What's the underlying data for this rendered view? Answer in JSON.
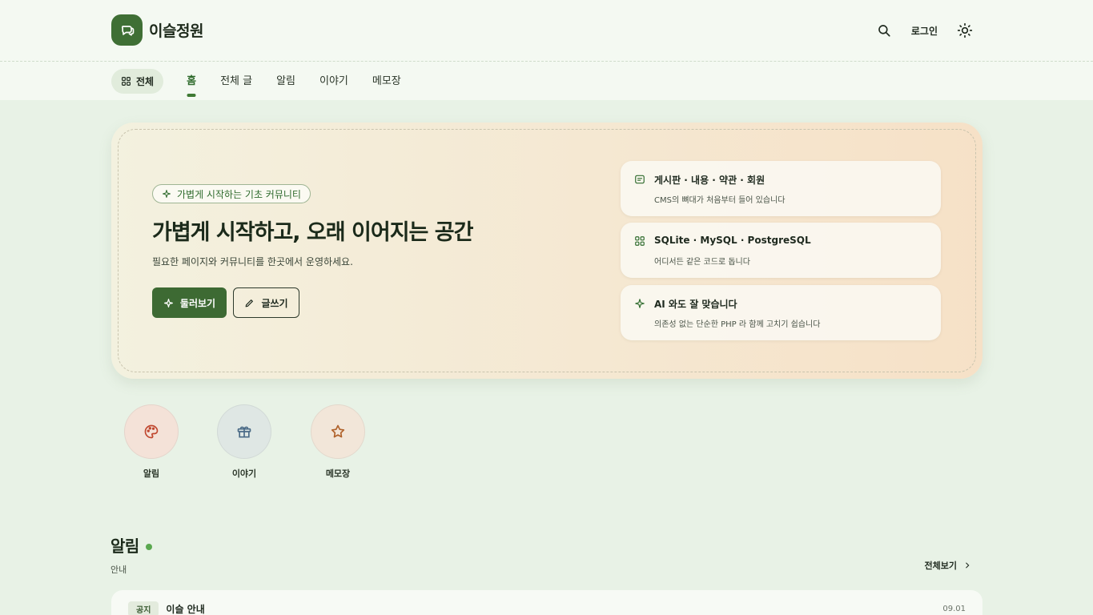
{
  "header": {
    "site_name": "이슬정원",
    "login_label": "로그인",
    "icons": [
      "chat-logo-icon",
      "search-icon",
      "sun-icon"
    ]
  },
  "nav": {
    "all_label": "전체",
    "items": [
      {
        "label": "홈",
        "active": true
      },
      {
        "label": "전체 글",
        "active": false
      },
      {
        "label": "알림",
        "active": false
      },
      {
        "label": "이야기",
        "active": false
      },
      {
        "label": "메모장",
        "active": false
      }
    ]
  },
  "hero": {
    "pill": "가볍게 시작하는 기초 커뮤니티",
    "title": "가볍게 시작하고, 오래 이어지는 공간",
    "description": "필요한 페이지와 커뮤니티를 한곳에서 운영하세요.",
    "primary_button": "둘러보기",
    "secondary_button": "글쓰기",
    "features": [
      {
        "title": "게시판 · 내용 · 약관 · 회원",
        "subtitle": "CMS의 뼈대가 처음부터 들어 있습니다",
        "icon": "board-icon"
      },
      {
        "title": "SQLite · MySQL · PostgreSQL",
        "subtitle": "어디서든 같은 코드로 돕니다",
        "icon": "grid-icon"
      },
      {
        "title": "AI 와도 잘 맞습니다",
        "subtitle": "의존성 없는 단순한 PHP 라 함께 고치기 쉽습니다",
        "icon": "sparkle-icon"
      }
    ]
  },
  "categories": [
    {
      "label": "알림",
      "icon": "palette-icon",
      "color": "#f4e2d8"
    },
    {
      "label": "이야기",
      "icon": "gift-icon",
      "color": "#dfe7e4"
    },
    {
      "label": "메모장",
      "icon": "star-icon",
      "color": "#f2e6d9"
    }
  ],
  "section": {
    "title": "알림",
    "subtitle": "안내",
    "see_all": "전체보기",
    "rows": [
      {
        "badge": "공지",
        "title": "이슬 안내",
        "date": "09.01"
      }
    ]
  },
  "colors": {
    "accent": "#3d6a33",
    "page_bg": "#e8f2e6",
    "header_bg": "#f4f9f2"
  }
}
